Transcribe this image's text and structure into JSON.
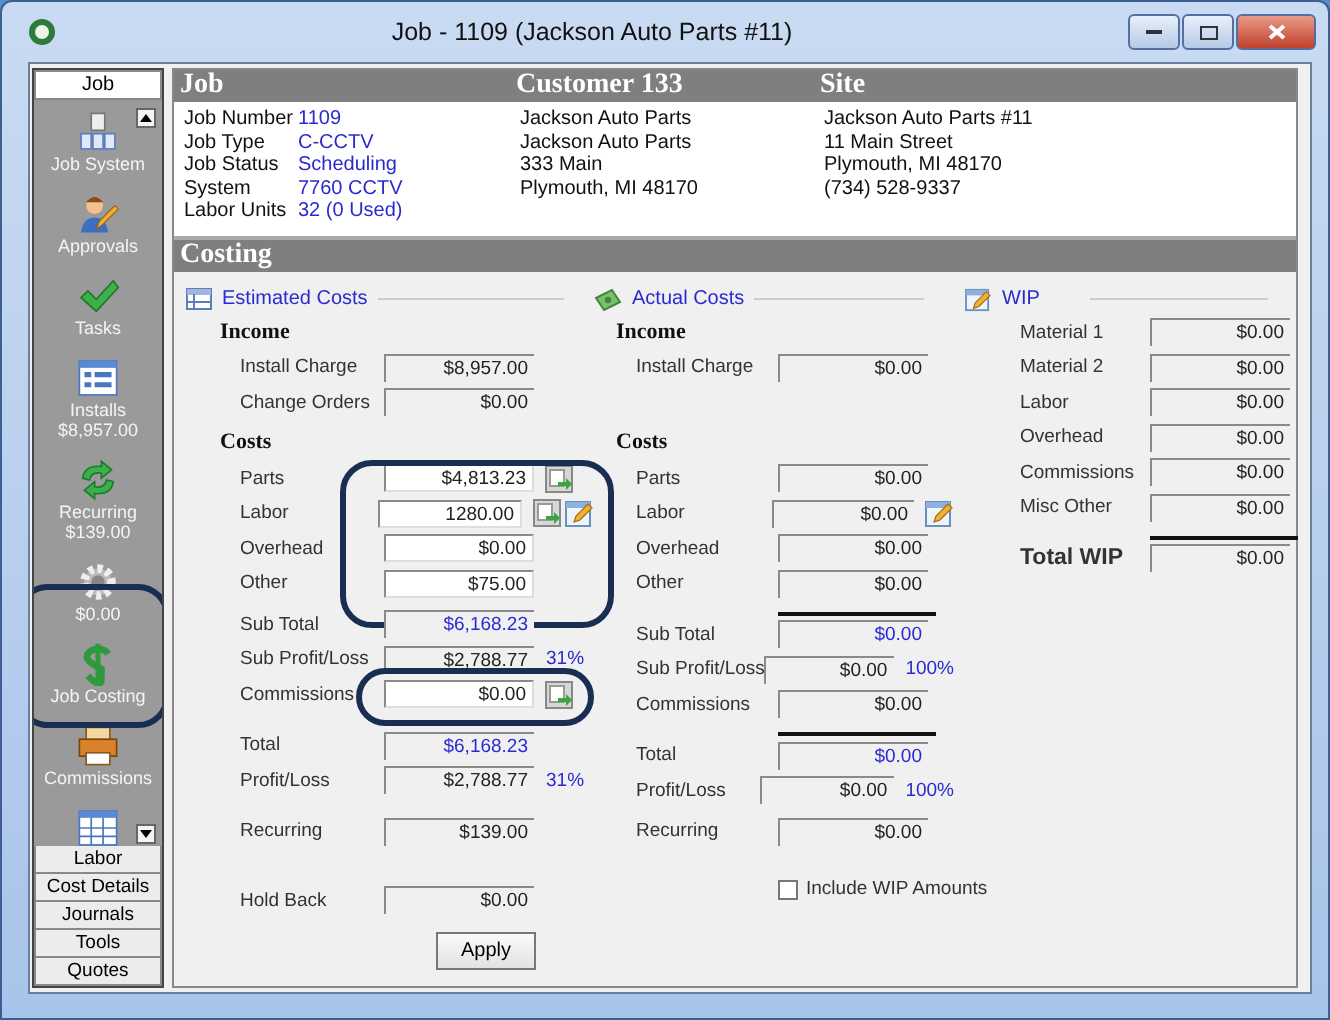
{
  "window": {
    "title": "Job - 1109 (Jackson Auto Parts #11)"
  },
  "sidebar": {
    "header": {
      "label": "Job",
      "selected": true
    },
    "items": [
      {
        "label": "Job System",
        "circled": false
      },
      {
        "label": "Approvals",
        "circled": false
      },
      {
        "label": "Tasks",
        "circled": false
      },
      {
        "label": "Installs",
        "sub": "$8,957.00",
        "circled": false
      },
      {
        "label": "Recurring",
        "sub": "$139.00",
        "circled": false
      },
      {
        "sub": "$0.00",
        "circled": false
      },
      {
        "label": "Job Costing",
        "circled": true
      },
      {
        "label": "Commissions",
        "circled": false
      },
      {
        "circled": false
      }
    ],
    "tabs": [
      {
        "label": "Labor"
      },
      {
        "label": "Cost Details"
      },
      {
        "label": "Journals"
      },
      {
        "label": "Tools"
      },
      {
        "label": "Quotes"
      }
    ]
  },
  "header": {
    "job": {
      "title": "Job",
      "fields": [
        {
          "label": "Job Number",
          "value": "1109"
        },
        {
          "label": "Job Type",
          "value": "C-CCTV"
        },
        {
          "label": "Job Status",
          "value": "Scheduling"
        },
        {
          "label": "System",
          "value": "7760 CCTV"
        },
        {
          "label": "Labor Units",
          "value": "32 (0 Used)"
        }
      ]
    },
    "customer": {
      "title": "Customer 133",
      "lines": [
        "Jackson Auto Parts",
        "Jackson Auto Parts",
        "333 Main",
        "Plymouth, MI  48170"
      ]
    },
    "site": {
      "title": "Site",
      "lines": [
        "Jackson Auto Parts #11",
        "11 Main Street",
        "Plymouth, MI  48170",
        "(734) 528-9337"
      ]
    }
  },
  "costing": {
    "title": "Costing",
    "estimated": {
      "title": "Estimated Costs",
      "sections": [
        {
          "heading": "Income",
          "rule": false,
          "circled": false,
          "rows": [
            {
              "label": "Install Charge",
              "value": "$8,957.00",
              "editable": false,
              "blue": false
            },
            {
              "label": "Change Orders",
              "value": "$0.00",
              "editable": false,
              "blue": false
            }
          ]
        },
        {
          "heading": "Costs",
          "rule": false,
          "circled": true,
          "rows": [
            {
              "label": "Parts",
              "value": "$4,813.23",
              "editable": true,
              "blue": false,
              "import_button": true,
              "edit_button": false
            },
            {
              "label": "Labor",
              "value": "1280.00",
              "editable": true,
              "blue": false,
              "import_button": true,
              "edit_button": true
            },
            {
              "label": "Overhead",
              "value": "$0.00",
              "editable": true,
              "blue": false
            },
            {
              "label": "Other",
              "value": "$75.00",
              "editable": true,
              "blue": false
            }
          ]
        },
        {
          "rule": false,
          "circled": false,
          "rows": [
            {
              "label": "Sub Total",
              "value": "$6,168.23",
              "editable": false,
              "blue": true
            },
            {
              "label": "Sub Profit/Loss",
              "value": "$2,788.77",
              "editable": false,
              "blue": false,
              "percent": "31%"
            },
            {
              "label": "Commissions",
              "value": "$0.00",
              "editable": true,
              "blue": false,
              "circled": true,
              "import_button": true,
              "edit_button": false
            }
          ]
        },
        {
          "rule": false,
          "circled": false,
          "rows": [
            {
              "label": "Total",
              "value": "$6,168.23",
              "editable": false,
              "blue": true
            },
            {
              "label": "Profit/Loss",
              "value": "$2,788.77",
              "editable": false,
              "blue": false,
              "percent": "31%"
            }
          ]
        },
        {
          "rule": false,
          "circled": false,
          "rows": [
            {
              "label": "Recurring",
              "value": "$139.00",
              "editable": false,
              "blue": false
            }
          ]
        },
        {
          "rule": false,
          "circled": false,
          "rows": [
            {
              "label": "Hold Back",
              "value": "$0.00",
              "editable": false,
              "blue": false
            }
          ]
        }
      ],
      "button": "Apply"
    },
    "actual": {
      "title": "Actual Costs",
      "sections": [
        {
          "heading": "Income",
          "rule": false,
          "circled": false,
          "rows": [
            {
              "label": "Install Charge",
              "value": "$0.00",
              "editable": false,
              "blue": false
            }
          ]
        },
        {
          "heading": "Costs",
          "rule": false,
          "circled": false,
          "rows": [
            {
              "label": "Parts",
              "value": "$0.00",
              "editable": false,
              "blue": false
            },
            {
              "label": "Labor",
              "value": "$0.00",
              "editable": false,
              "blue": false,
              "import_button": false,
              "edit_button": true
            },
            {
              "label": "Overhead",
              "value": "$0.00",
              "editable": false,
              "blue": false
            },
            {
              "label": "Other",
              "value": "$0.00",
              "editable": false,
              "blue": false
            }
          ]
        },
        {
          "rule": true,
          "circled": false,
          "rows": [
            {
              "label": "Sub Total",
              "value": "$0.00",
              "editable": false,
              "blue": true
            },
            {
              "label": "Sub Profit/Loss",
              "value": "$0.00",
              "editable": false,
              "blue": false,
              "percent": "100%"
            },
            {
              "label": "Commissions",
              "value": "$0.00",
              "editable": false,
              "blue": false
            }
          ]
        },
        {
          "rule": true,
          "circled": false,
          "rows": [
            {
              "label": "Total",
              "value": "$0.00",
              "editable": false,
              "blue": true
            },
            {
              "label": "Profit/Loss",
              "value": "$0.00",
              "editable": false,
              "blue": false,
              "percent": "100%"
            }
          ]
        },
        {
          "rule": false,
          "circled": false,
          "rows": [
            {
              "label": "Recurring",
              "value": "$0.00",
              "editable": false,
              "blue": false
            }
          ]
        }
      ],
      "checkbox": {
        "label": "Include WIP Amounts",
        "checked": false
      }
    },
    "wip": {
      "title": "WIP",
      "sections": [
        {
          "rule": false,
          "circled": false,
          "rows": [
            {
              "label": "Material 1",
              "value": "$0.00",
              "editable": false,
              "blue": false,
              "bold": false
            },
            {
              "label": "Material 2",
              "value": "$0.00",
              "editable": false,
              "blue": false,
              "bold": false
            },
            {
              "label": "Labor",
              "value": "$0.00",
              "editable": false,
              "blue": false,
              "bold": false
            },
            {
              "label": "Overhead",
              "value": "$0.00",
              "editable": false,
              "blue": false,
              "bold": false
            },
            {
              "label": "Commissions",
              "value": "$0.00",
              "editable": false,
              "blue": false,
              "bold": false
            },
            {
              "label": "Misc Other",
              "value": "$0.00",
              "editable": false,
              "blue": false,
              "bold": false
            }
          ]
        },
        {
          "rule": true,
          "circled": false,
          "rows": [
            {
              "label": "Total WIP",
              "value": "$0.00",
              "editable": false,
              "blue": false,
              "bold": true
            }
          ]
        }
      ]
    }
  }
}
